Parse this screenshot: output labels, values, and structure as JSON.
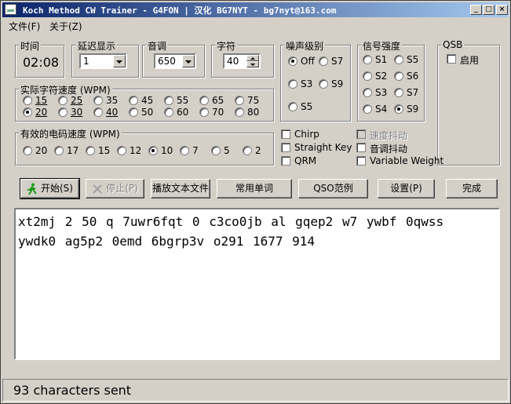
{
  "window": {
    "title": "Koch Method CW Trainer - G4FON | 汉化 BG7NYT - bg7nyt@163.com",
    "min_glyph": "_",
    "max_glyph": "□",
    "close_glyph": "×"
  },
  "menu": [
    {
      "label": "文件(F)"
    },
    {
      "label": "关于(Z)"
    }
  ],
  "time": {
    "legend": "时间",
    "value": "02:08"
  },
  "delay": {
    "legend": "延迟显示",
    "value": "1"
  },
  "tone": {
    "legend": "音调",
    "value": "650"
  },
  "chars": {
    "legend": "字符",
    "value": "40"
  },
  "noise": {
    "legend": "噪声级别",
    "options": [
      {
        "label": "Off",
        "selected": true
      },
      {
        "label": "S7",
        "selected": false
      },
      {
        "label": "S3",
        "selected": false
      },
      {
        "label": "S9",
        "selected": false
      },
      {
        "label": "S5",
        "selected": false
      }
    ]
  },
  "signal": {
    "legend": "信号强度",
    "options": [
      {
        "label": "S1",
        "selected": false
      },
      {
        "label": "S5",
        "selected": false
      },
      {
        "label": "S2",
        "selected": false
      },
      {
        "label": "S6",
        "selected": false
      },
      {
        "label": "S3",
        "selected": false
      },
      {
        "label": "S7",
        "selected": false
      },
      {
        "label": "S4",
        "selected": false
      },
      {
        "label": "S9",
        "selected": true
      }
    ]
  },
  "qsb": {
    "legend": "QSB",
    "enable_label": "启用",
    "checked": false
  },
  "char_speed": {
    "legend": "实际字符速度 (WPM)",
    "options": [
      {
        "label": "15",
        "selected": false
      },
      {
        "label": "25",
        "selected": false
      },
      {
        "label": "35",
        "selected": false
      },
      {
        "label": "45",
        "selected": false
      },
      {
        "label": "55",
        "selected": false
      },
      {
        "label": "65",
        "selected": false
      },
      {
        "label": "75",
        "selected": false
      },
      {
        "label": "20",
        "selected": true
      },
      {
        "label": "30",
        "selected": false
      },
      {
        "label": "40",
        "selected": false
      },
      {
        "label": "50",
        "selected": false
      },
      {
        "label": "60",
        "selected": false
      },
      {
        "label": "70",
        "selected": false
      },
      {
        "label": "80",
        "selected": false
      }
    ]
  },
  "effective_speed": {
    "legend": "有效的电码速度 (WPM)",
    "options": [
      {
        "label": "20",
        "selected": false
      },
      {
        "label": "17",
        "selected": false
      },
      {
        "label": "15",
        "selected": false
      },
      {
        "label": "12",
        "selected": false
      },
      {
        "label": "10",
        "selected": true
      },
      {
        "label": "7",
        "selected": false
      },
      {
        "label": "5",
        "selected": false
      },
      {
        "label": "2",
        "selected": false
      }
    ]
  },
  "options_left": [
    {
      "label": "Chirp",
      "checked": false,
      "enabled": true
    },
    {
      "label": "Straight Key",
      "checked": false,
      "enabled": true
    },
    {
      "label": "QRM",
      "checked": false,
      "enabled": true
    }
  ],
  "options_right": [
    {
      "label": "速度抖动",
      "checked": false,
      "enabled": false
    },
    {
      "label": "音调抖动",
      "checked": false,
      "enabled": true
    },
    {
      "label": "Variable Weight",
      "checked": false,
      "enabled": true
    }
  ],
  "buttons": {
    "start": "开始(S)",
    "stop": "停止(P)",
    "play_file": "播放文本文件",
    "common_words": "常用单词",
    "qso": "QSO范例",
    "settings": "设置(P)",
    "done": "完成"
  },
  "output": {
    "lines": [
      "xt2mj 2 50 q 7uwr6fqt 0 c3co0jb al gqep2 w7 ywbf 0qwss",
      "ywdk0 ag5p2 0emd 6bgrp3v o291 1677 914"
    ]
  },
  "status": {
    "text": "93 characters sent"
  },
  "colors": {
    "title_start": "#0a246a",
    "title_end": "#a6caf0",
    "face": "#d4d0c8",
    "start_icon": "#1c9a1c"
  }
}
